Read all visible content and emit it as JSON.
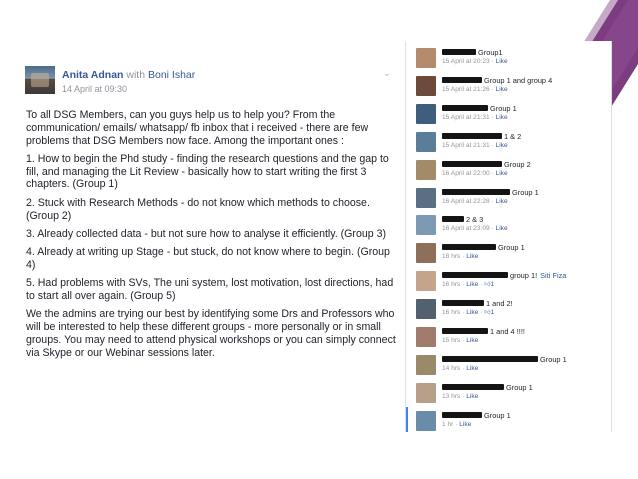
{
  "post": {
    "author": "Anita Adnan",
    "connector": "with",
    "target": "Boni Ishar",
    "timestamp": "14 April at 09:30",
    "paragraphs": [
      "To all DSG Members, can you guys help us to help you? From the communication/ emails/ whatsapp/ fb inbox that i received - there are few problems that DSG Members now face. Among the important ones :",
      "1. How to begin the Phd study - finding the research questions and the gap to fill, and managing the Lit Review - basically how to start writing the first 3 chapters. (Group 1)",
      "2. Stuck with Research Methods - do not know which methods to choose. (Group 2)",
      "3. Already collected data - but not sure how to analyse it efficiently. (Group 3)",
      "4. Already at writing up Stage - but stuck, do not know where to begin. (Group 4)",
      "5. Had problems with SVs, The uni system, lost motivation, lost directions, had to start all over again. (Group 5)",
      "We the admins are trying our best by identifying some Drs and Professors who will be interested to help these different groups - more personally or in small groups. You may need to attend physical workshops or you can simply connect via Skype or our Webinar sessions later."
    ]
  },
  "comments": [
    {
      "text": "Group1",
      "time": "15 April at 20:23",
      "like": "Like",
      "likes": ""
    },
    {
      "text": "Group 1 and group 4",
      "time": "15 April at 21:26",
      "like": "Like",
      "likes": ""
    },
    {
      "text": "Group 1",
      "time": "15 April at 21:31",
      "like": "Like",
      "likes": ""
    },
    {
      "text": "1 & 2",
      "time": "15 April at 21:31",
      "like": "Like",
      "likes": ""
    },
    {
      "text": "Group 2",
      "time": "16 April at 22:00",
      "like": "Like",
      "likes": ""
    },
    {
      "text": "Group 1",
      "time": "16 April at 22:28",
      "like": "Like",
      "likes": ""
    },
    {
      "text": "2 & 3",
      "time": "16 April at 23:09",
      "like": "Like",
      "likes": ""
    },
    {
      "text": "Group 1",
      "time": "18 hrs",
      "like": "Like",
      "likes": ""
    },
    {
      "text": "group 1!",
      "tag": "Siti Fiza",
      "time": "16 hrs",
      "like": "Like",
      "likes": "1"
    },
    {
      "text": "1 and 2!",
      "time": "16 hrs",
      "like": "Like",
      "likes": "1"
    },
    {
      "text": "1 and 4 !!!!",
      "time": "15 hrs",
      "like": "Like",
      "likes": ""
    },
    {
      "text": "Group 1",
      "time": "14 hrs",
      "like": "Like",
      "likes": ""
    },
    {
      "text": "Group 1",
      "time": "13 hrs",
      "like": "Like",
      "likes": ""
    },
    {
      "text": "Group 1",
      "time": "1 hr",
      "like": "Like",
      "likes": ""
    }
  ],
  "colors": {
    "link": "#365899",
    "meta": "#90949c",
    "text": "#1d2129",
    "accent_purple": "#7c3c80"
  }
}
